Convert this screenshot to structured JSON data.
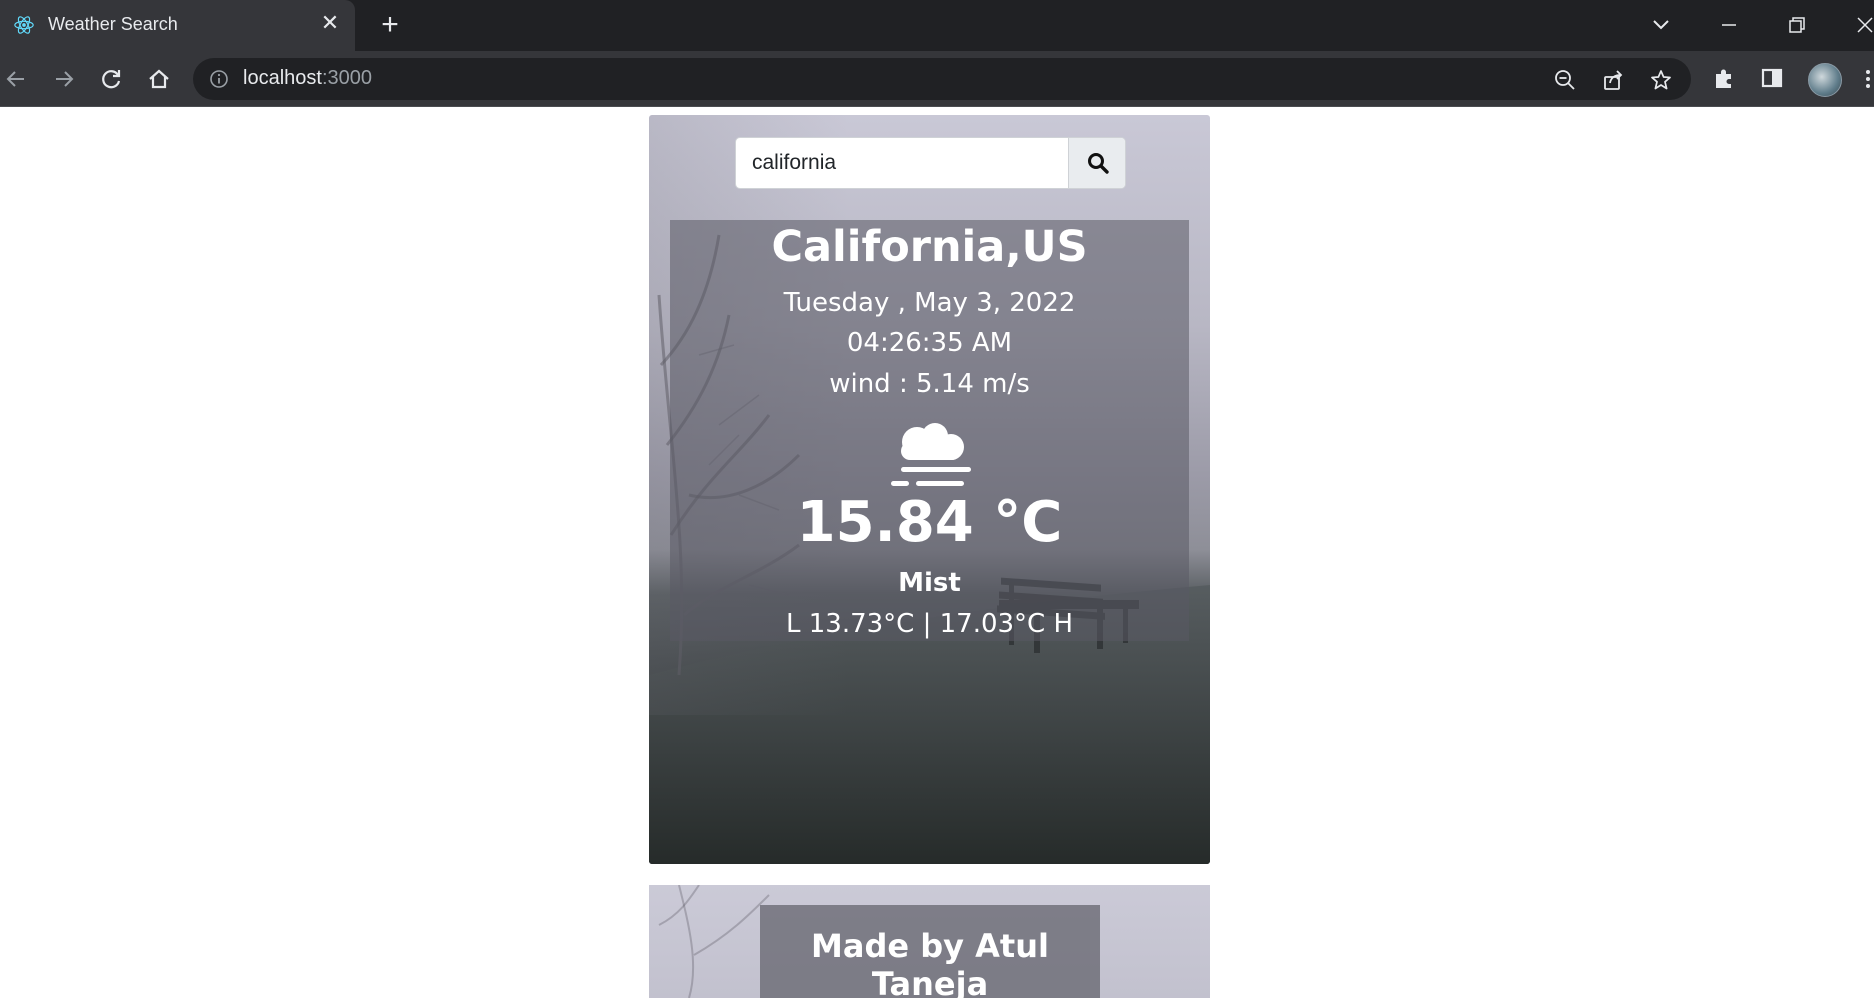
{
  "browser": {
    "tab_title": "Weather Search",
    "tab_close": "✕",
    "new_tab": "+",
    "url_host": "localhost",
    "url_port": ":3000"
  },
  "search": {
    "value": "california",
    "button_icon": "search-icon"
  },
  "weather": {
    "city": "California,US",
    "date": "Tuesday , May 3, 2022",
    "time": "04:26:35 AM",
    "wind": "wind : 5.14 m/s",
    "icon": "mist-icon",
    "temperature": "15.84 °C",
    "condition": "Mist",
    "range": "L 13.73°C | 17.03°C H"
  },
  "footer": {
    "text": "Made by Atul Taneja"
  },
  "colors": {
    "chrome_dark": "#202124",
    "chrome_toolbar": "#35363a",
    "panel_overlay": "rgba(90,90,100,0.55)"
  }
}
